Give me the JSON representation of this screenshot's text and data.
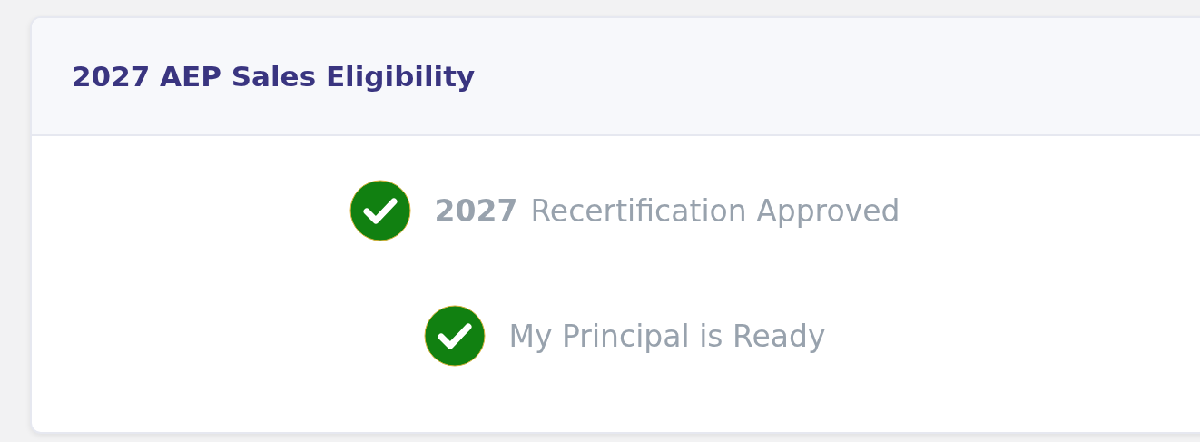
{
  "card": {
    "title": "2027 AEP Sales Eligibility",
    "items": [
      {
        "year": "2027",
        "label": "Recertification Approved",
        "complete": true
      },
      {
        "label": "My Principal is Ready",
        "complete": true
      }
    ]
  }
}
